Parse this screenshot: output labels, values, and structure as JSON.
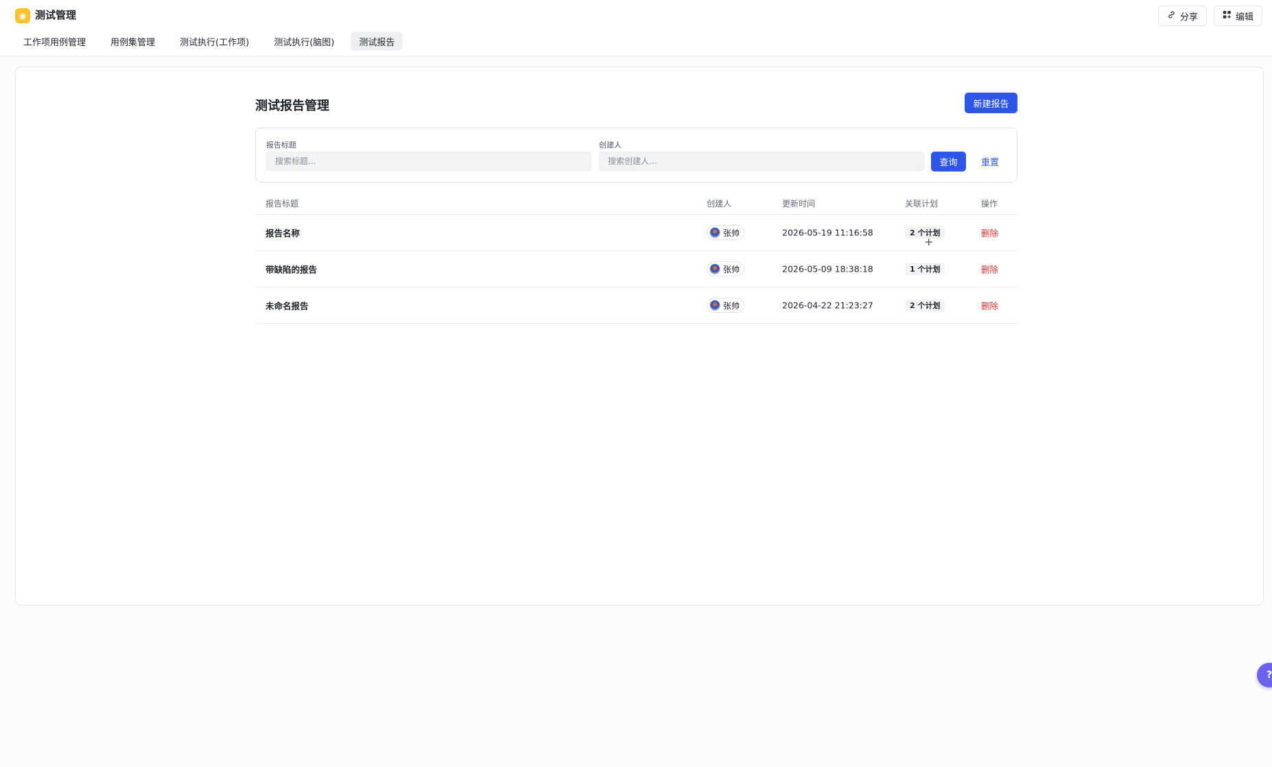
{
  "app": {
    "title": "测试管理",
    "logo_icon": "app-logo-icon"
  },
  "top_actions": {
    "share_label": "分享",
    "share_icon": "link-icon",
    "edit_label": "编辑",
    "edit_icon": "grid-plus-icon"
  },
  "tabs": [
    {
      "label": "工作项用例管理",
      "active": false
    },
    {
      "label": "用例集管理",
      "active": false
    },
    {
      "label": "测试执行(工作项)",
      "active": false
    },
    {
      "label": "测试执行(脑图)",
      "active": false
    },
    {
      "label": "测试报告",
      "active": true
    }
  ],
  "page": {
    "title": "测试报告管理",
    "new_button_label": "新建报告"
  },
  "filters": {
    "title_label": "报告标题",
    "title_placeholder": "搜索标题...",
    "creator_label": "创建人",
    "creator_placeholder": "搜索创建人...",
    "query_label": "查询",
    "reset_label": "重置"
  },
  "table": {
    "columns": [
      "报告标题",
      "创建人",
      "更新时间",
      "关联计划",
      "操作"
    ],
    "rows": [
      {
        "title": "报告名称",
        "creator": "张帅",
        "updated": "2026-05-19 11:16:58",
        "plans": "2 个计划",
        "action": "删除"
      },
      {
        "title": "带缺陷的报告",
        "creator": "张帅",
        "updated": "2026-05-09 18:38:18",
        "plans": "1 个计划",
        "action": "删除"
      },
      {
        "title": "未命名报告",
        "creator": "张帅",
        "updated": "2026-04-22 21:23:27",
        "plans": "2 个计划",
        "action": "删除"
      }
    ]
  },
  "help": {
    "glyph": "?"
  },
  "colors": {
    "primary": "#2d55e6",
    "danger": "#e03131",
    "logo": "#f8c22e",
    "help": "#6b63f0"
  }
}
